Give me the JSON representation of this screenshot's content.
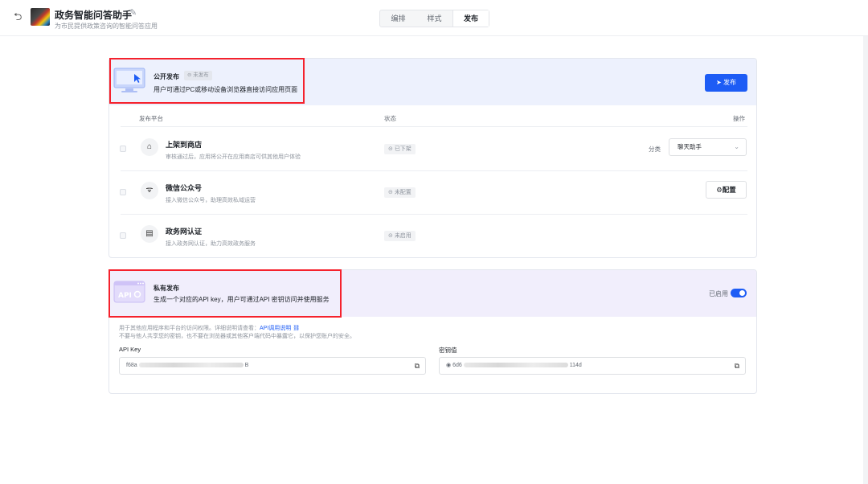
{
  "header": {
    "back_icon": "undo-arrow-icon",
    "app_title": "政务智能问答助手",
    "app_subtitle": "为市民提供政策咨询的智能问答应用",
    "tabs": [
      "编排",
      "样式",
      "发布"
    ],
    "active_tab": "发布"
  },
  "public_publish": {
    "title": "公开发布",
    "badge": "未发布",
    "description": "用户可通过PC或移动设备浏览器直接访问应用页面",
    "publish_button": "发布",
    "columns": {
      "platform": "发布平台",
      "status": "状态",
      "action": "操作"
    },
    "rows": [
      {
        "icon": "store-icon",
        "title": "上架到商店",
        "desc": "审核通过后，应用将公开在应用商店可供其他用户体验",
        "status": "已下架",
        "category_label": "分类",
        "category_value": "聊天助手"
      },
      {
        "icon": "wechat-icon",
        "title": "微信公众号",
        "desc": "接入微信公众号，助理高效私域运营",
        "status": "未配置",
        "config_button": "配置"
      },
      {
        "icon": "id-card-icon",
        "title": "政务网认证",
        "desc": "接入政务网认证，助力高效政务服务",
        "status": "未启用"
      }
    ]
  },
  "private_publish": {
    "title": "私有发布",
    "description": "生成一个对应的API key，用户可通过API 密钥访问并使用服务",
    "toggle_label": "已启用",
    "toggle_on": true,
    "info_line1": "用于其他应用程序和平台的访问权限。详细说明请查看：",
    "info_link": "API调用说明",
    "info_line2": "不要与他人共享您的密钥，也不要在浏览器或其他客户端代码中暴露它，以保护您账户的安全。",
    "api_key_label": "API Key",
    "api_key_prefix": "f68a",
    "api_key_suffix": "B",
    "secret_label": "密钥值",
    "secret_prefix": "6d6",
    "secret_suffix": "114d"
  },
  "colors": {
    "accent": "#1d5cf5",
    "highlight_box": "#f5222d"
  }
}
